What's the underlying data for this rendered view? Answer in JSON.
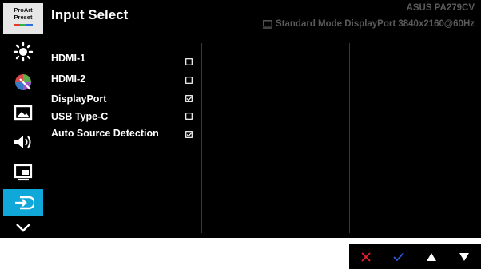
{
  "sidebar": {
    "preset": {
      "line1": "ProArt",
      "line2": "Preset"
    },
    "items": [
      {
        "icon": "brightness-icon"
      },
      {
        "icon": "color-icon"
      },
      {
        "icon": "image-icon"
      },
      {
        "icon": "sound-icon"
      },
      {
        "icon": "pip-icon"
      },
      {
        "icon": "input-select-icon",
        "active": true
      },
      {
        "icon": "chevron-down-icon"
      }
    ],
    "active_color": "#0fa8d9"
  },
  "header": {
    "title": "Input Select",
    "model": "ASUS PA279CV",
    "status": "Standard Mode DisplayPort 3840x2160@60Hz"
  },
  "options": [
    {
      "label": "HDMI-1",
      "checked": false
    },
    {
      "label": "HDMI-2",
      "checked": false
    },
    {
      "label": "DisplayPort",
      "checked": true
    },
    {
      "label": "USB Type-C",
      "checked": false
    },
    {
      "label": "Auto Source Detection",
      "checked": true
    }
  ],
  "controls": [
    {
      "icon": "close-icon",
      "color": "#e8202a"
    },
    {
      "icon": "check-icon",
      "color": "#2a5ad8"
    },
    {
      "icon": "triangle-up-icon",
      "color": "#ffffff"
    },
    {
      "icon": "triangle-down-icon",
      "color": "#ffffff"
    }
  ]
}
